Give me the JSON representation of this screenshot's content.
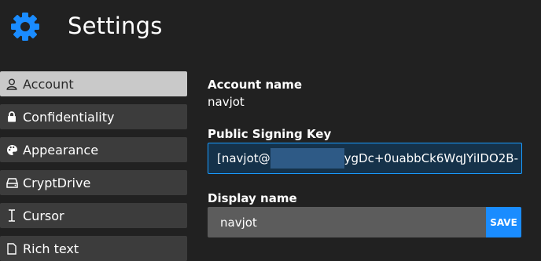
{
  "header": {
    "title": "Settings",
    "icon": "gear-icon",
    "icon_color": "#1a8cff"
  },
  "sidebar": {
    "items": [
      {
        "label": "Account",
        "icon": "user-icon",
        "active": true
      },
      {
        "label": "Confidentiality",
        "icon": "lock-icon"
      },
      {
        "label": "Appearance",
        "icon": "palette-icon"
      },
      {
        "label": "CryptDrive",
        "icon": "drive-icon"
      },
      {
        "label": "Cursor",
        "icon": "text-cursor-icon"
      },
      {
        "label": "Rich text",
        "icon": "rich-text-icon"
      }
    ]
  },
  "account": {
    "account_name_label": "Account name",
    "account_name_value": "navjot",
    "signing_key_label": "Public Signing Key",
    "signing_key_prefix": "[navjot@",
    "signing_key_suffix": "ygDc+0uabbCk6WqJYiIDO2B-",
    "display_name_label": "Display name",
    "display_name_value": "navjot",
    "save_label": "SAVE"
  },
  "colors": {
    "accent": "#1a8cff",
    "background": "#212121",
    "sidebar_item": "#3c3c3c",
    "sidebar_active": "#c9c9c9"
  }
}
